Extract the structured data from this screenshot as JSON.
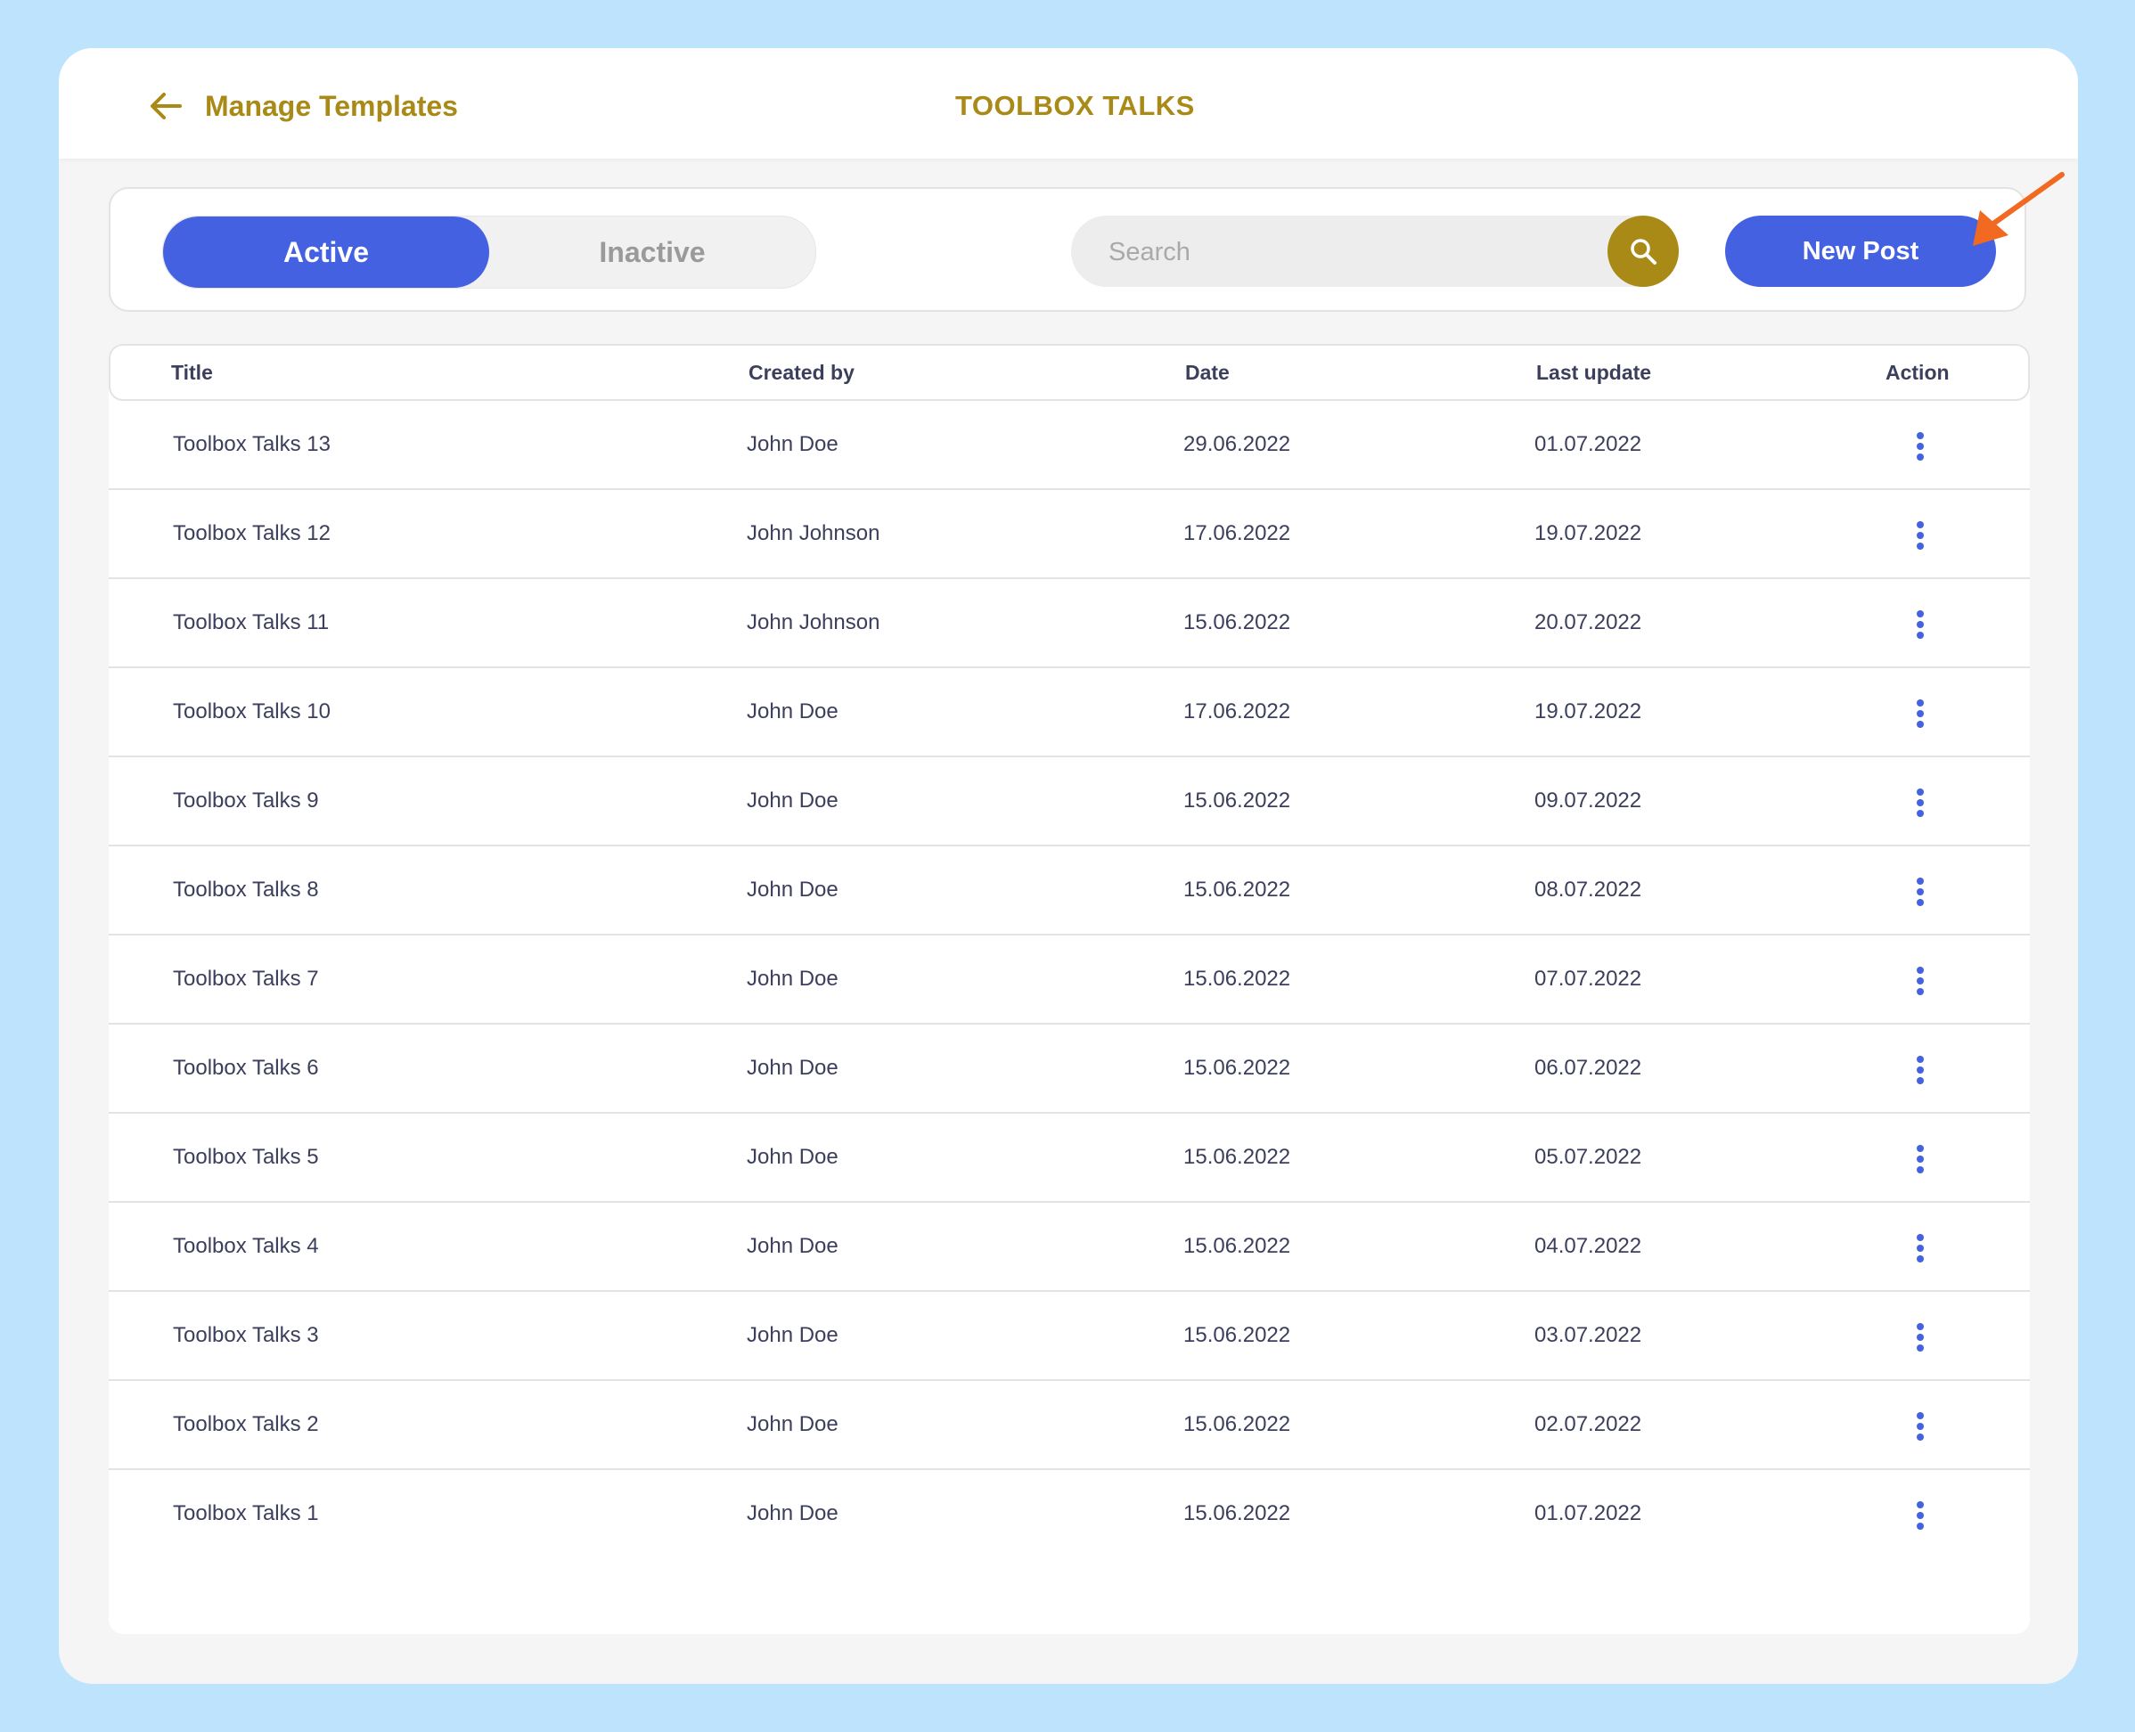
{
  "header": {
    "back_label": "Manage Templates",
    "title": "TOOLBOX TALKS"
  },
  "toolbar": {
    "tabs": [
      {
        "label": "Active",
        "selected": true
      },
      {
        "label": "Inactive",
        "selected": false
      }
    ],
    "search_placeholder": "Search",
    "new_post_label": "New Post"
  },
  "table": {
    "columns": [
      "Title",
      "Created by",
      "Date",
      "Last update",
      "Action"
    ],
    "rows": [
      {
        "title": "Toolbox Talks 13",
        "created_by": "John Doe",
        "date": "29.06.2022",
        "last_update": "01.07.2022"
      },
      {
        "title": "Toolbox Talks 12",
        "created_by": "John Johnson",
        "date": "17.06.2022",
        "last_update": "19.07.2022"
      },
      {
        "title": "Toolbox Talks 11",
        "created_by": "John Johnson",
        "date": "15.06.2022",
        "last_update": "20.07.2022"
      },
      {
        "title": "Toolbox Talks 10",
        "created_by": "John Doe",
        "date": "17.06.2022",
        "last_update": "19.07.2022"
      },
      {
        "title": "Toolbox Talks 9",
        "created_by": "John Doe",
        "date": "15.06.2022",
        "last_update": "09.07.2022"
      },
      {
        "title": "Toolbox Talks 8",
        "created_by": "John Doe",
        "date": "15.06.2022",
        "last_update": "08.07.2022"
      },
      {
        "title": "Toolbox Talks 7",
        "created_by": "John Doe",
        "date": "15.06.2022",
        "last_update": "07.07.2022"
      },
      {
        "title": "Toolbox Talks 6",
        "created_by": "John Doe",
        "date": "15.06.2022",
        "last_update": "06.07.2022"
      },
      {
        "title": "Toolbox Talks 5",
        "created_by": "John Doe",
        "date": "15.06.2022",
        "last_update": "05.07.2022"
      },
      {
        "title": "Toolbox Talks 4",
        "created_by": "John Doe",
        "date": "15.06.2022",
        "last_update": "04.07.2022"
      },
      {
        "title": "Toolbox Talks 3",
        "created_by": "John Doe",
        "date": "15.06.2022",
        "last_update": "03.07.2022"
      },
      {
        "title": "Toolbox Talks 2",
        "created_by": "John Doe",
        "date": "15.06.2022",
        "last_update": "02.07.2022"
      },
      {
        "title": "Toolbox Talks 1",
        "created_by": "John Doe",
        "date": "15.06.2022",
        "last_update": "01.07.2022"
      }
    ]
  },
  "icons": {
    "back": "arrow-left-icon",
    "search": "search-icon",
    "row_action": "more-vertical-icon",
    "annotation": "callout-arrow-icon"
  },
  "colors": {
    "accent_gold": "#a98a16",
    "primary_blue": "#4361e1",
    "annotation_orange": "#f26a21",
    "background": "#bde3fd"
  }
}
